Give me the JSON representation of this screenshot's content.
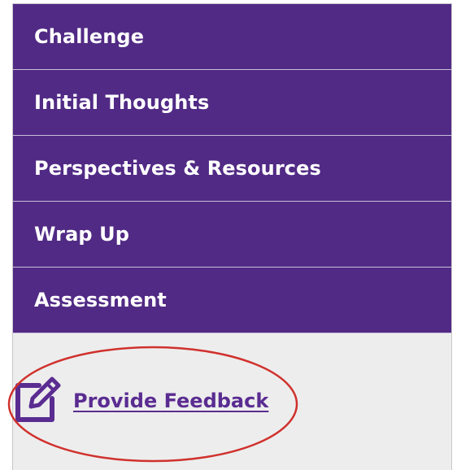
{
  "nav": {
    "items": [
      {
        "label": "Challenge"
      },
      {
        "label": "Initial Thoughts"
      },
      {
        "label": "Perspectives & Resources"
      },
      {
        "label": "Wrap Up"
      },
      {
        "label": "Assessment"
      }
    ]
  },
  "feedback": {
    "label": "Provide Feedback",
    "icon": "edit-icon"
  },
  "colors": {
    "nav_background": "#512a85",
    "nav_text": "#ffffff",
    "panel_background": "#ededed",
    "link": "#5a2c91",
    "highlight": "#d0312d"
  }
}
